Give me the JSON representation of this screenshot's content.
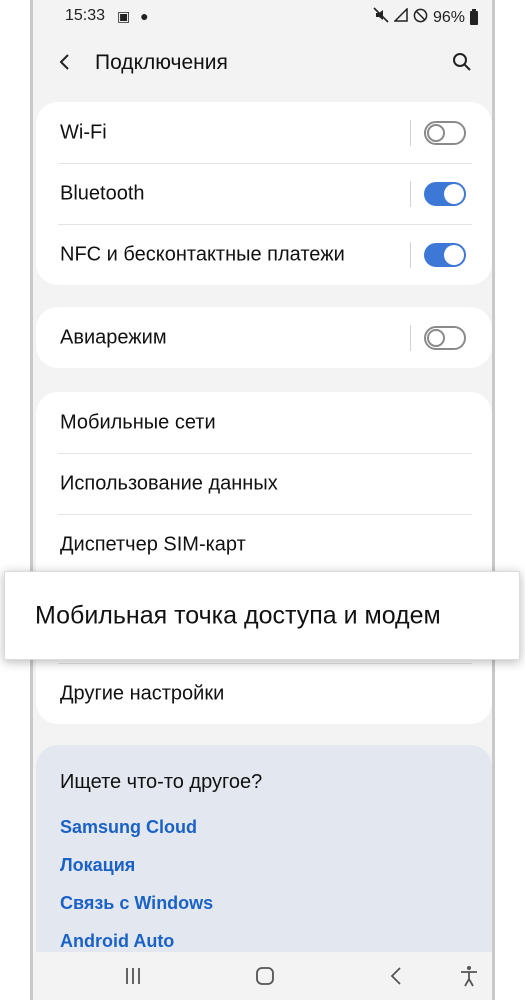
{
  "status_bar": {
    "time": "15:33",
    "left_icons": [
      "gallery-icon",
      "account-icon"
    ],
    "right_icons": [
      "mute-icon",
      "signal-icon",
      "no-sim-icon"
    ],
    "battery": "96%"
  },
  "header": {
    "title": "Подключения"
  },
  "group1": [
    {
      "label": "Wi-Fi",
      "toggle": "off"
    },
    {
      "label": "Bluetooth",
      "toggle": "on"
    },
    {
      "label": "NFC и бесконтактные платежи",
      "toggle": "on"
    }
  ],
  "group2": [
    {
      "label": "Авиарежим",
      "toggle": "off"
    }
  ],
  "group3": [
    {
      "label": "Мобильные сети"
    },
    {
      "label": "Использование данных"
    },
    {
      "label": "Диспетчер SIM-карт"
    },
    {
      "label": "Мобильная точка доступа и модем"
    },
    {
      "label": "Другие настройки"
    }
  ],
  "suggest": {
    "title": "Ищете что-то другое?",
    "links": [
      "Samsung Cloud",
      "Локация",
      "Связь с Windows",
      "Android Auto"
    ]
  },
  "colors": {
    "accent": "#3e78d6",
    "link": "#1b62c7",
    "background": "#f3f3f3",
    "suggest_bg": "#e3e8f0"
  }
}
